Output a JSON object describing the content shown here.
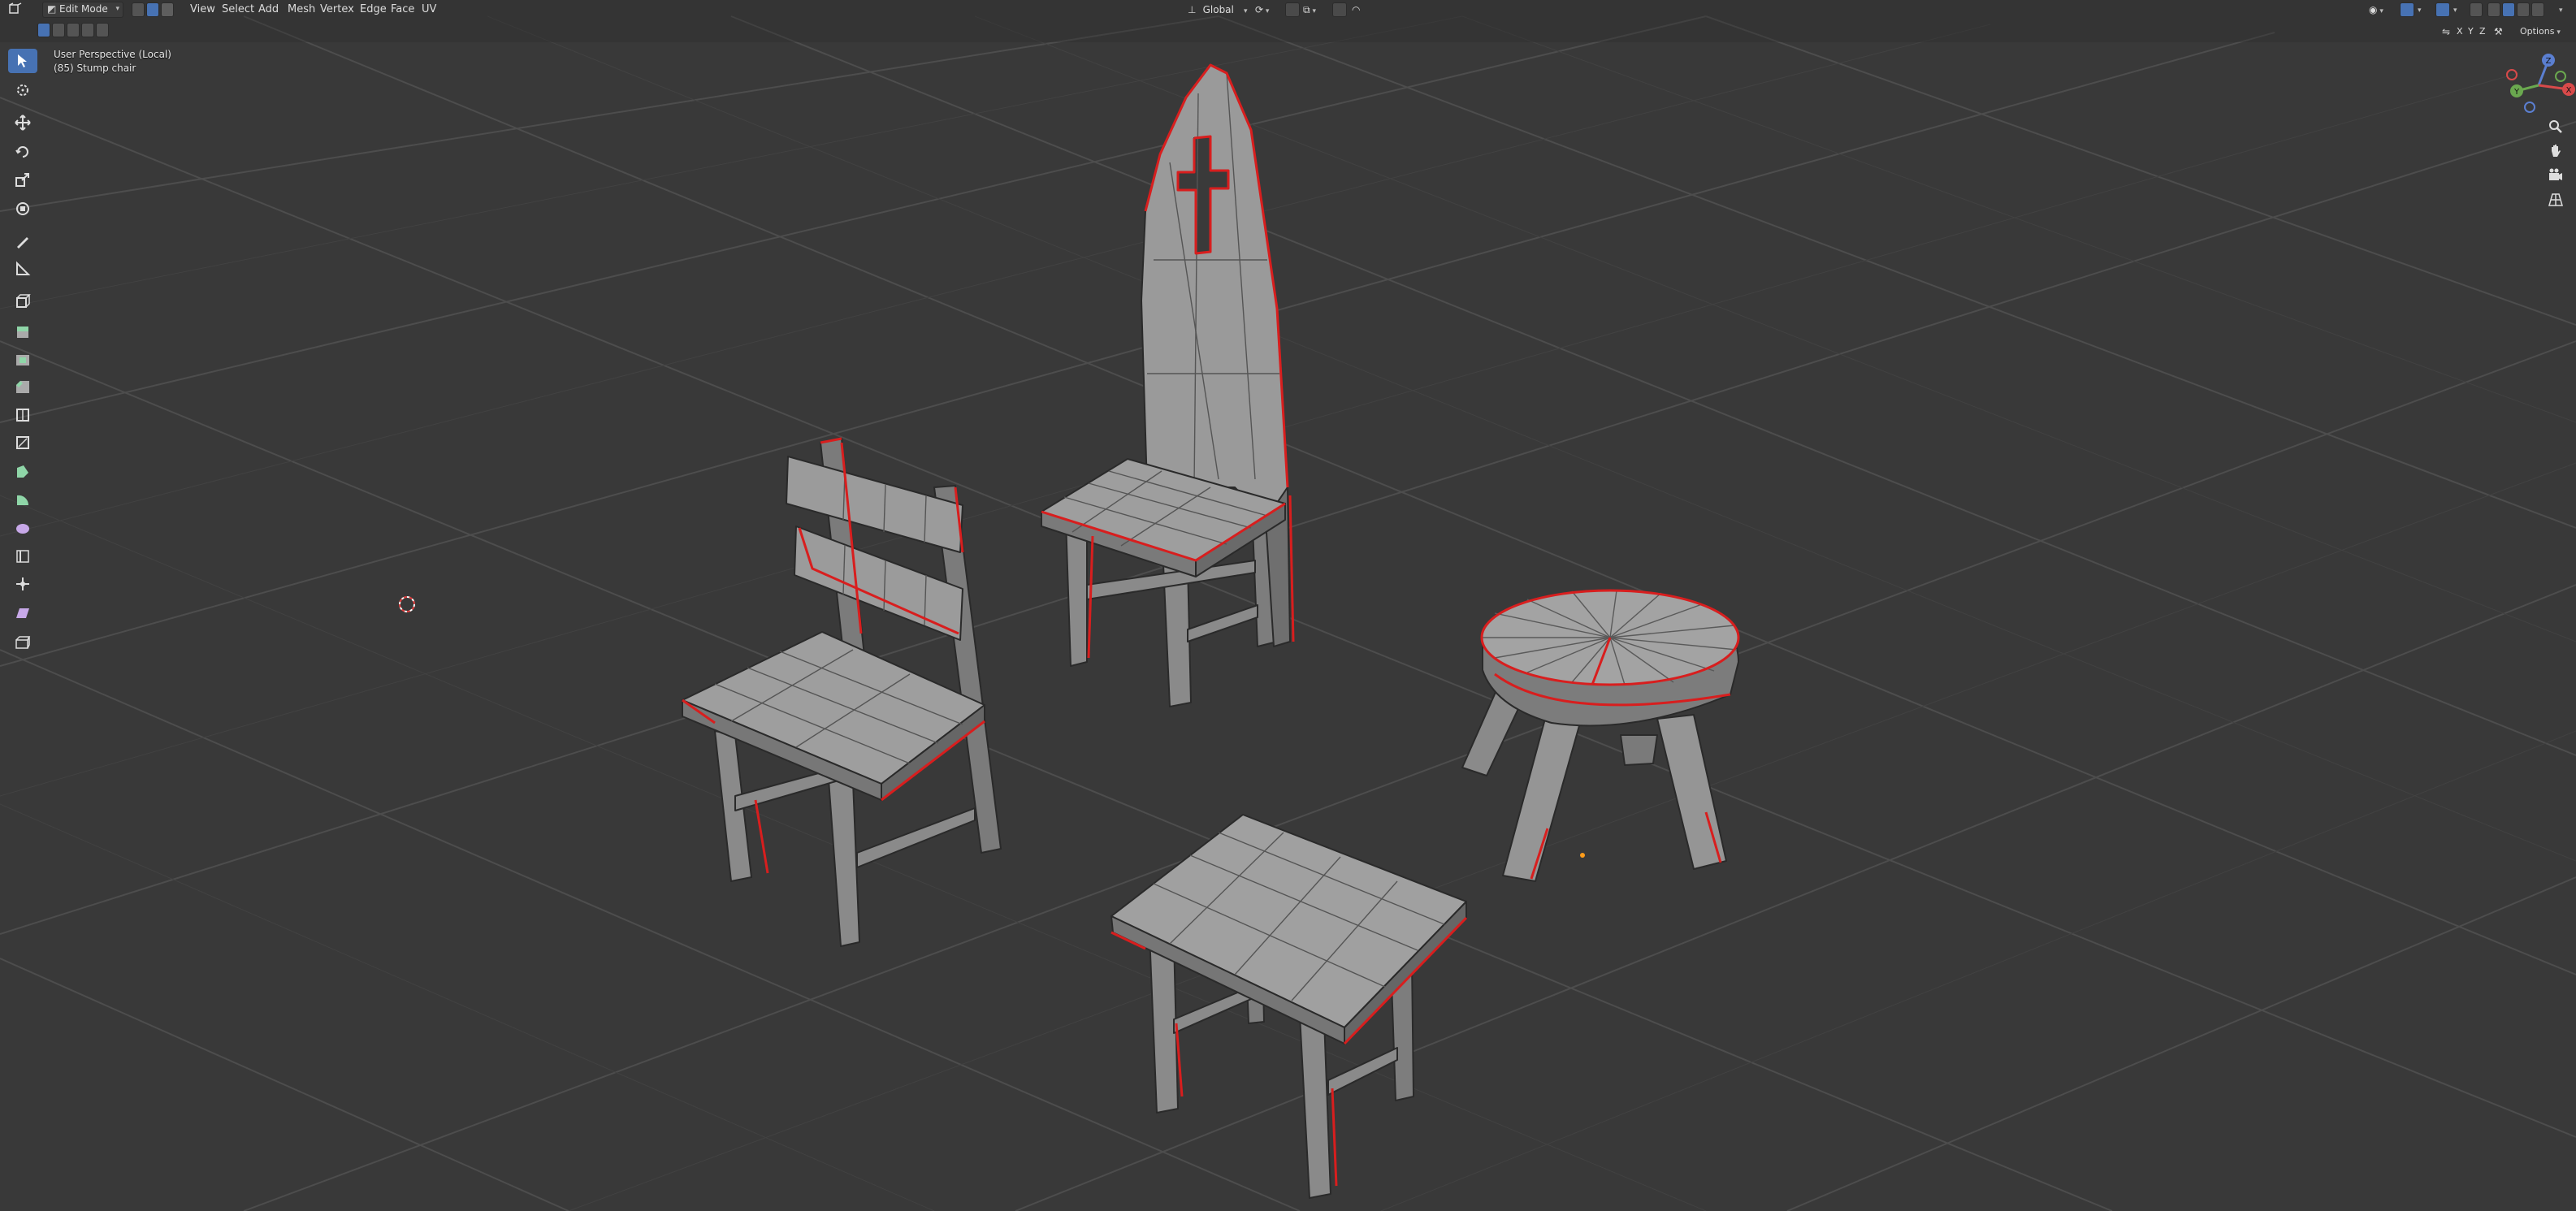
{
  "header": {
    "mode_label": "Edit Mode",
    "menus": [
      "View",
      "Select",
      "Add",
      "Mesh",
      "Vertex",
      "Edge",
      "Face",
      "UV"
    ],
    "transform_orientation": "Global",
    "options_label": "Options",
    "axis_x": "X",
    "axis_y": "Y",
    "axis_z": "Z"
  },
  "viewport": {
    "view_name": "User Perspective (Local)",
    "object_name": "(85) Stump chair"
  },
  "gizmo": {
    "x": "X",
    "y": "Y",
    "z": "Z"
  },
  "toolbar": {
    "tools": [
      "select-box",
      "cursor",
      "move",
      "rotate",
      "scale",
      "transform",
      "annotate",
      "measure",
      "add-cube",
      "extrude-region",
      "inset-faces",
      "bevel",
      "loop-cut",
      "knife",
      "poly-build",
      "spin",
      "smooth",
      "edge-slide",
      "shrink-fatten",
      "shear",
      "rip-region"
    ]
  },
  "colors": {
    "background": "#393939",
    "grid": "#4a4a4a",
    "mesh_fill": "#8e8e8e",
    "mesh_edge": "#2a2a2a",
    "seam": "#d81e1e",
    "accent": "#4772b3"
  }
}
